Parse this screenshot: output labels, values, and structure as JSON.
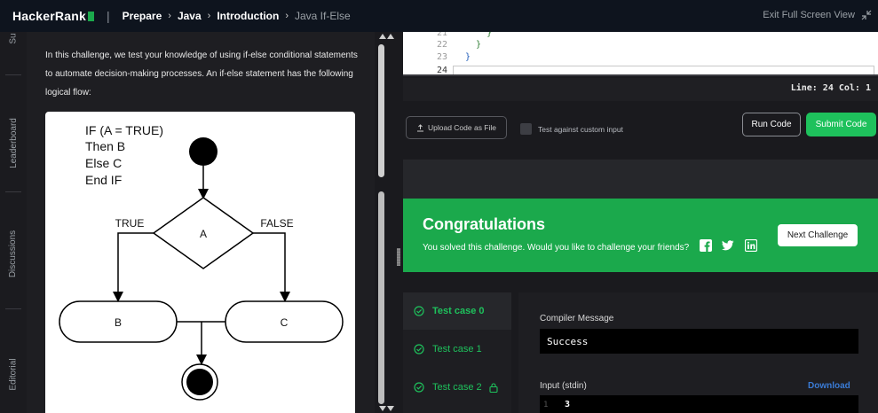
{
  "header": {
    "logo": "HackerRank",
    "breadcrumb": [
      "Prepare",
      "Java",
      "Introduction",
      "Java If-Else"
    ],
    "exit_fullscreen": "Exit Full Screen View"
  },
  "side_tabs": {
    "top_partial": "Su",
    "leaderboard": "Leaderboard",
    "discussions": "Discussions",
    "editorial": "Editorial"
  },
  "problem": {
    "intro": "In this challenge, we test your knowledge of using if-else conditional statements to automate decision-making processes. An if-else statement has the following logical flow:",
    "flowchart": {
      "code_lines": [
        "IF (A = TRUE)",
        "Then B",
        "Else C",
        "End IF"
      ],
      "true_label": "TRUE",
      "false_label": "FALSE",
      "decision": "A",
      "left_box": "B",
      "right_box": "C"
    }
  },
  "editor": {
    "lines": [
      {
        "num": "21",
        "text": "    }"
      },
      {
        "num": "22",
        "text": "  }"
      },
      {
        "num": "23",
        "text": "}"
      },
      {
        "num": "24",
        "text": ""
      }
    ],
    "status": "Line: 24 Col: 1"
  },
  "actions": {
    "upload": "Upload Code as File",
    "custom_input": "Test against custom input",
    "run": "Run Code",
    "submit": "Submit Code"
  },
  "result": {
    "title": "Congratulations",
    "subtitle": "You solved this challenge. Would you like to challenge your friends?",
    "next": "Next Challenge",
    "social": [
      "facebook-icon",
      "twitter-icon",
      "linkedin-icon"
    ]
  },
  "test_cases": [
    {
      "label": "Test case 0",
      "locked": false
    },
    {
      "label": "Test case 1",
      "locked": false
    },
    {
      "label": "Test case 2",
      "locked": true
    }
  ],
  "output": {
    "compiler_label": "Compiler Message",
    "compiler_value": "Success",
    "input_label": "Input (stdin)",
    "download": "Download",
    "input_line_num": "1",
    "input_value": "3"
  },
  "colors": {
    "accent_green": "#1ba94c",
    "submit_green": "#1ec15c",
    "link_blue": "#3a7bd5",
    "bg_dark": "#1a1a1e"
  }
}
